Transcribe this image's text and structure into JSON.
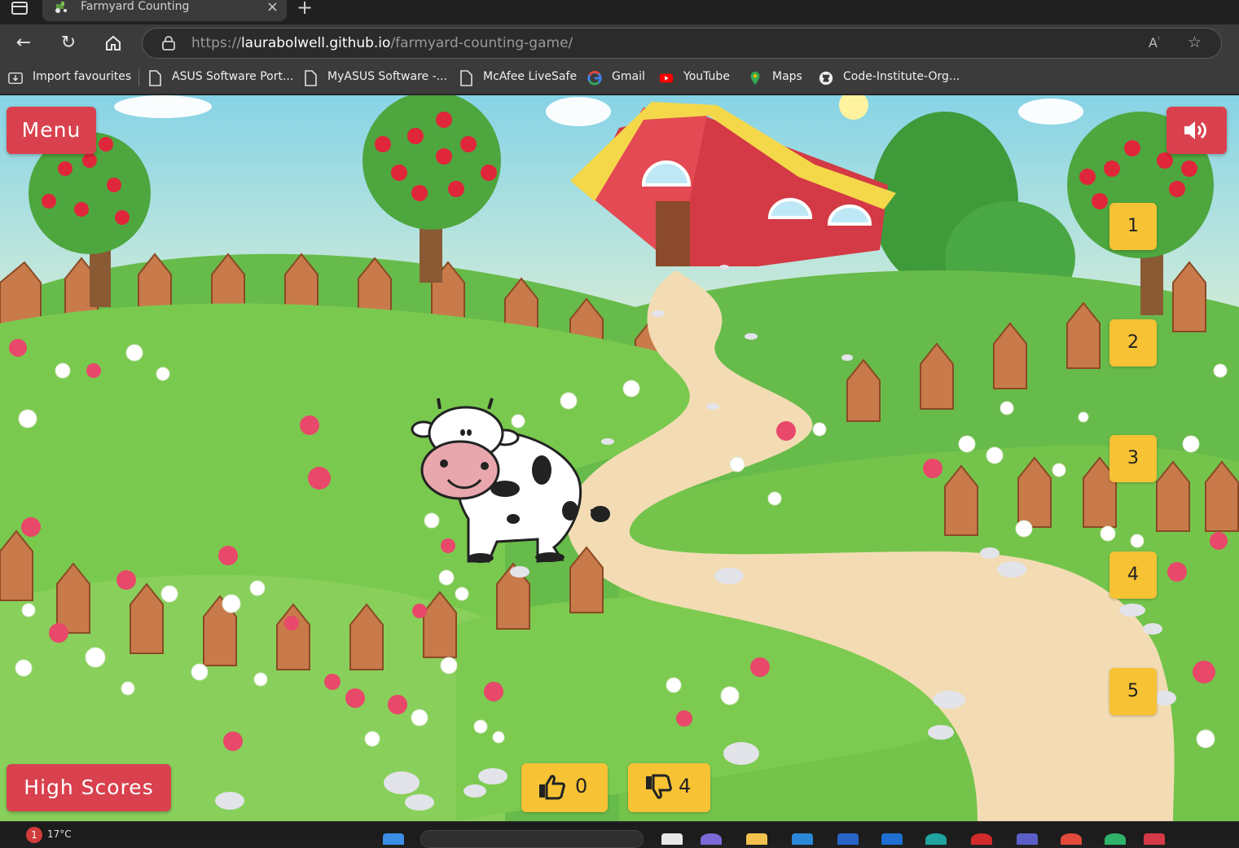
{
  "browser": {
    "tab_title": "Farmyard Counting",
    "url_scheme": "https://",
    "url_host": "laurabolwell.github.io",
    "url_path": "/farmyard-counting-game/",
    "bookmarks": [
      {
        "label": "Import favourites",
        "icon": "import-icon"
      },
      {
        "label": "ASUS Software Port...",
        "icon": "page-icon"
      },
      {
        "label": "MyASUS Software -...",
        "icon": "page-icon"
      },
      {
        "label": "McAfee LiveSafe",
        "icon": "page-icon"
      },
      {
        "label": "Gmail",
        "icon": "google-icon"
      },
      {
        "label": "YouTube",
        "icon": "youtube-icon"
      },
      {
        "label": "Maps",
        "icon": "maps-icon"
      },
      {
        "label": "Code-Institute-Org...",
        "icon": "github-icon"
      }
    ]
  },
  "game": {
    "menu_label": "Menu",
    "high_scores_label": "High Scores",
    "sound_icon": "speaker-volume-icon",
    "answers": [
      "1",
      "2",
      "3",
      "4",
      "5"
    ],
    "correct_score": "0",
    "incorrect_score": "4",
    "animal": "cow",
    "colors": {
      "red_button": "#d9414e",
      "yellow_button": "#f7c234"
    }
  },
  "taskbar": {
    "notification_count": "1",
    "temperature": "17°C"
  }
}
